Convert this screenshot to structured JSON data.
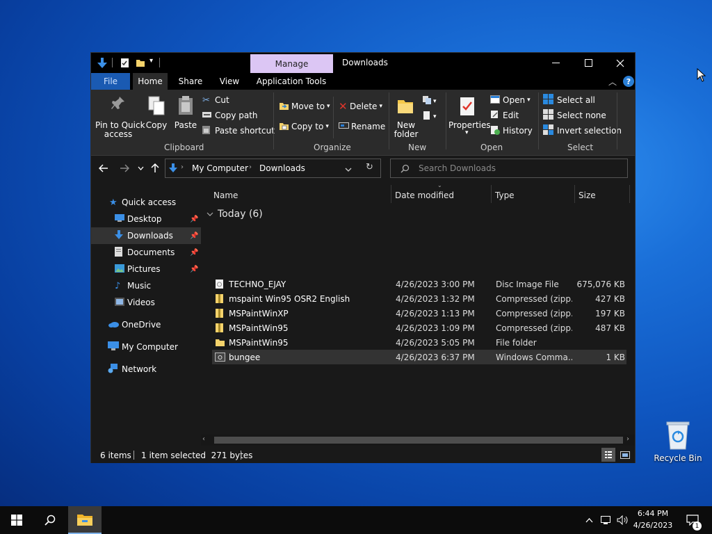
{
  "window": {
    "title": "Downloads",
    "contextual_tab": "Manage",
    "minimize": "—",
    "maximize": "☐",
    "close": "✕"
  },
  "ribbon_tabs": [
    "File",
    "Home",
    "Share",
    "View",
    "Application Tools"
  ],
  "clipboard": {
    "pin": "Pin to Quick",
    "pin2": "access",
    "copy": "Copy",
    "paste": "Paste",
    "cut": "Cut",
    "copy_path": "Copy path",
    "paste_shortcut": "Paste shortcut",
    "label": "Clipboard"
  },
  "organize": {
    "move_to": "Move to",
    "copy_to": "Copy to",
    "delete": "Delete",
    "rename": "Rename",
    "label": "Organize"
  },
  "new_group": {
    "new_folder": "New",
    "new_folder2": "folder",
    "label": "New"
  },
  "open_group": {
    "properties": "Properties",
    "open": "Open",
    "edit": "Edit",
    "history": "History",
    "label": "Open"
  },
  "select_group": {
    "select_all": "Select all",
    "select_none": "Select none",
    "invert": "Invert selection",
    "label": "Select"
  },
  "address": {
    "segments": [
      "My Computer",
      "Downloads"
    ],
    "search_placeholder": "Search Downloads"
  },
  "sidebar": [
    {
      "label": "Quick access",
      "icon": "star-icon"
    },
    {
      "label": "Desktop",
      "icon": "desktop-icon",
      "pinned": true
    },
    {
      "label": "Downloads",
      "icon": "download-icon",
      "pinned": true,
      "selected": true
    },
    {
      "label": "Documents",
      "icon": "document-icon",
      "pinned": true
    },
    {
      "label": "Pictures",
      "icon": "picture-icon",
      "pinned": true
    },
    {
      "label": "Music",
      "icon": "music-icon"
    },
    {
      "label": "Videos",
      "icon": "video-icon"
    },
    {
      "label": "OneDrive",
      "icon": "cloud-icon"
    },
    {
      "label": "My Computer",
      "icon": "computer-icon"
    },
    {
      "label": "Network",
      "icon": "network-icon"
    }
  ],
  "columns": [
    "Name",
    "Date modified",
    "Type",
    "Size"
  ],
  "group_header": "Today (6)",
  "files": [
    {
      "name": "TECHNO_EJAY",
      "date": "4/26/2023 3:00 PM",
      "type": "Disc Image File",
      "size": "675,076 KB",
      "icon": "disc-image-icon"
    },
    {
      "name": "mspaint Win95 OSR2 English",
      "date": "4/26/2023 1:32 PM",
      "type": "Compressed (zipp...",
      "size": "427 KB",
      "icon": "zip-folder-icon"
    },
    {
      "name": "MSPaintWinXP",
      "date": "4/26/2023 1:13 PM",
      "type": "Compressed (zipp...",
      "size": "197 KB",
      "icon": "zip-folder-icon"
    },
    {
      "name": "MSPaintWin95",
      "date": "4/26/2023 1:09 PM",
      "type": "Compressed (zipp...",
      "size": "487 KB",
      "icon": "zip-folder-icon"
    },
    {
      "name": "MSPaintWin95",
      "date": "4/26/2023 5:05 PM",
      "type": "File folder",
      "size": "",
      "icon": "folder-icon"
    },
    {
      "name": "bungee",
      "date": "4/26/2023 6:37 PM",
      "type": "Windows Comma...",
      "size": "1 KB",
      "icon": "cmd-file-icon",
      "selected": true
    }
  ],
  "status": {
    "items": "6 items",
    "selected": "1 item selected  271 bytes"
  },
  "desktop": {
    "recycle_bin": "Recycle Bin"
  },
  "taskbar": {
    "time": "6:44 PM",
    "date": "4/26/2023",
    "notification_count": "1"
  },
  "colors": {
    "accent": "#1a5ab2",
    "manage_tab": "#dcc6f4",
    "window_bg": "#191919",
    "ribbon_bg": "#2b2b2b"
  }
}
